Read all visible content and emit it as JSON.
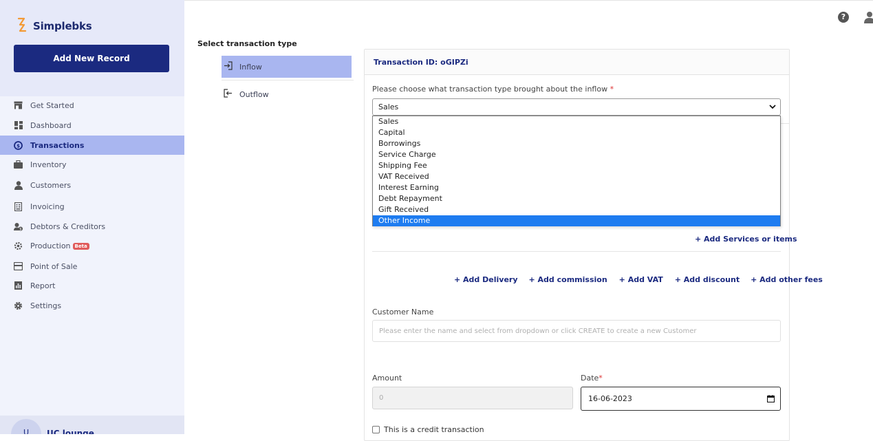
{
  "app": {
    "name": "Simplebks",
    "add_record_label": "Add New Record"
  },
  "sidebar": {
    "items": [
      {
        "label": "Get Started",
        "icon": "store-icon"
      },
      {
        "label": "Dashboard",
        "icon": "dashboard-icon"
      },
      {
        "label": "Transactions",
        "icon": "transactions-icon",
        "active": true
      },
      {
        "label": "Inventory",
        "icon": "briefcase-icon"
      },
      {
        "label": "Customers",
        "icon": "person-icon"
      },
      {
        "label": "Invoicing",
        "icon": "invoice-icon"
      },
      {
        "label": "Debtors & Creditors",
        "icon": "debtors-icon"
      },
      {
        "label": "Production",
        "icon": "production-icon",
        "badge": "Beta"
      },
      {
        "label": "Point of Sale",
        "icon": "pos-icon"
      },
      {
        "label": "Report",
        "icon": "report-icon"
      },
      {
        "label": "Settings",
        "icon": "gear-icon"
      }
    ],
    "user": {
      "initials": "U",
      "name": "UC lounge"
    }
  },
  "type_select": {
    "title": "Select transaction type",
    "options": [
      {
        "label": "Inflow",
        "active": true
      },
      {
        "label": "Outflow",
        "active": false
      }
    ]
  },
  "form": {
    "transaction_id_label": "Transaction ID: oGIPZi",
    "type_question": "Please choose what transaction type brought about the inflow",
    "required_mark": "*",
    "type_selected": "Sales",
    "type_options": [
      "Sales",
      "Capital",
      "Borrowings",
      "Service Charge",
      "Shipping Fee",
      "VAT Received",
      "Interest Earning",
      "Debt Repayment",
      "Gift Received",
      "Other Income"
    ],
    "highlighted_option": "Other Income",
    "add_services_label": "+ Add Services or items",
    "fee_links": [
      "+ Add Delivery",
      "+ Add commission",
      "+ Add VAT",
      "+ Add discount",
      "+ Add other fees"
    ],
    "customer_label": "Customer Name",
    "customer_placeholder": "Please enter the name and select from dropdown or click CREATE to create a new Customer",
    "amount_label": "Amount",
    "amount_placeholder": "0",
    "date_label": "Date",
    "date_value": "16-06-2023",
    "credit_label": "This is a credit transaction"
  },
  "colors": {
    "brand": "#1b2a80",
    "active_bg": "#a9b6f0",
    "highlight": "#1e7cf0",
    "sidebar_bg": "#f1f3fc"
  }
}
